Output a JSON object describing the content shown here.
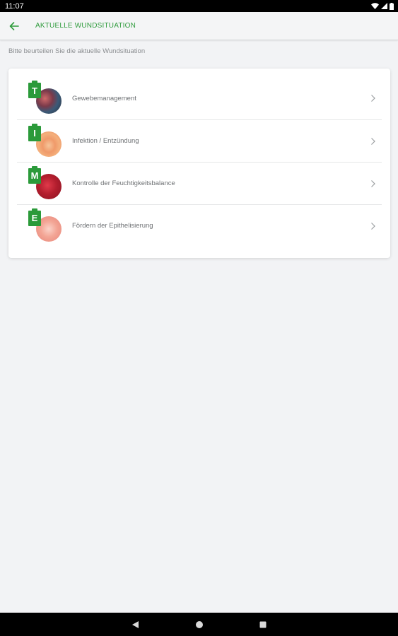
{
  "status_bar": {
    "time": "11:07",
    "icons": [
      "wifi-icon",
      "signal-icon",
      "battery-icon"
    ]
  },
  "app_bar": {
    "back_icon": "arrow-left-icon",
    "title": "AKTUELLE WUNDSITUATION"
  },
  "subtitle": "Bitte beurteilen Sie die aktuelle Wundsituation",
  "items": [
    {
      "badge": "T",
      "label": "Gewebemanagement",
      "icon": "chevron-right-icon"
    },
    {
      "badge": "I",
      "label": "Infektion / Entzündung",
      "icon": "chevron-right-icon"
    },
    {
      "badge": "M",
      "label": "Kontrolle der Feuchtigkeitsbalance",
      "icon": "chevron-right-icon"
    },
    {
      "badge": "E",
      "label": "Fördern der Epithelisierung",
      "icon": "chevron-right-icon"
    }
  ],
  "nav_bar": {
    "buttons": [
      "back-triangle-icon",
      "home-circle-icon",
      "recents-square-icon"
    ]
  },
  "colors": {
    "accent": "#2e9b3c",
    "background": "#f2f3f5"
  }
}
